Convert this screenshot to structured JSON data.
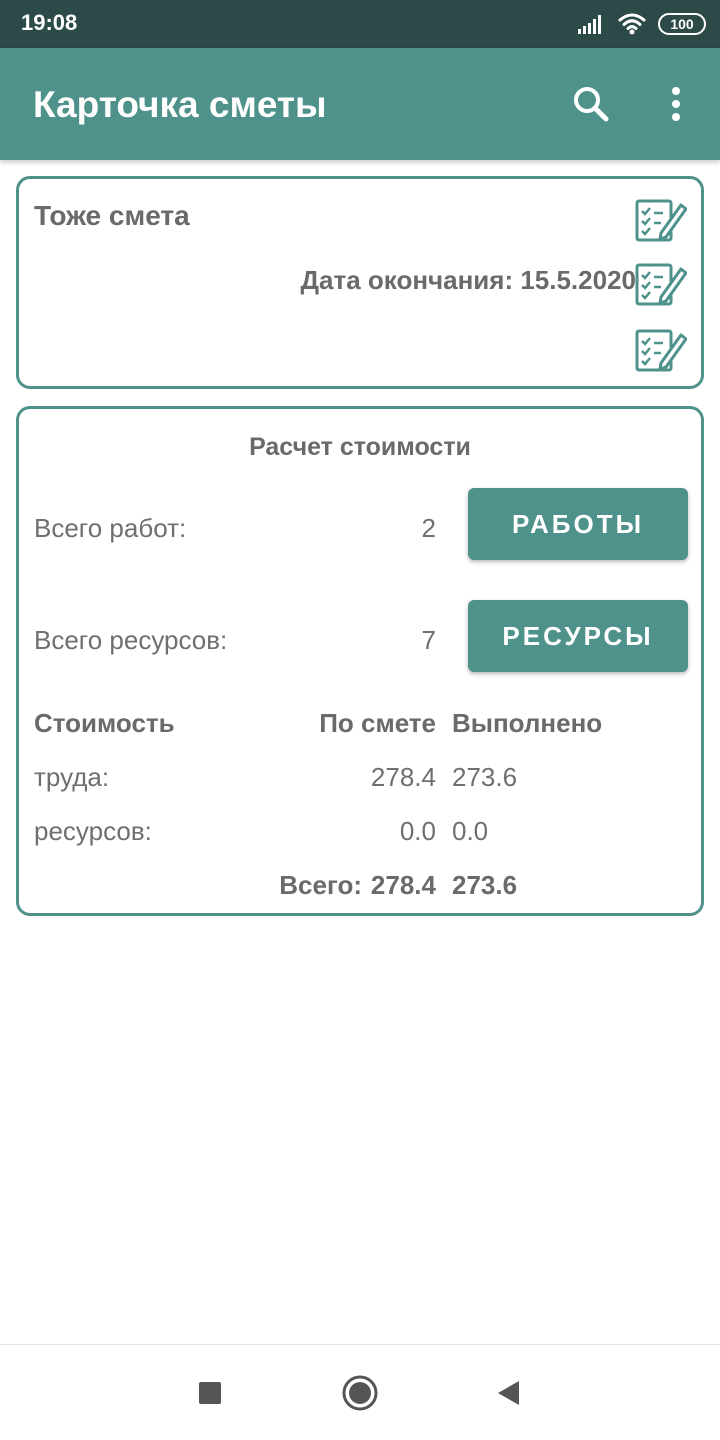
{
  "status_bar": {
    "time": "19:08",
    "battery": "100"
  },
  "app_bar": {
    "title": "Карточка сметы",
    "actions": [
      "search-icon",
      "more-vert-icon"
    ]
  },
  "estimate": {
    "name": "Тоже смета",
    "end_date": "Дата окончания: 15.5.2020"
  },
  "calc": {
    "title": "Расчет стоимости",
    "works_label": "Всего работ:",
    "works_count": "2",
    "works_button": "РАБОТЫ",
    "resources_label": "Всего ресурсов:",
    "resources_count": "7",
    "resources_button": "РЕСУРСЫ",
    "headers": {
      "cost": "Стоимость",
      "planned": "По смете",
      "done": "Выполнено"
    },
    "rows": [
      {
        "label": "труда:",
        "planned": "278.4",
        "done": "273.6"
      },
      {
        "label": "ресурсов:",
        "planned": "0.0",
        "done": "0.0"
      }
    ],
    "total": {
      "label": "Всего:",
      "planned": "278.4",
      "done": "273.6"
    }
  },
  "colors": {
    "status_bar": "#2c4a48",
    "accent": "#4f918b",
    "text": "#6f6f6f"
  }
}
